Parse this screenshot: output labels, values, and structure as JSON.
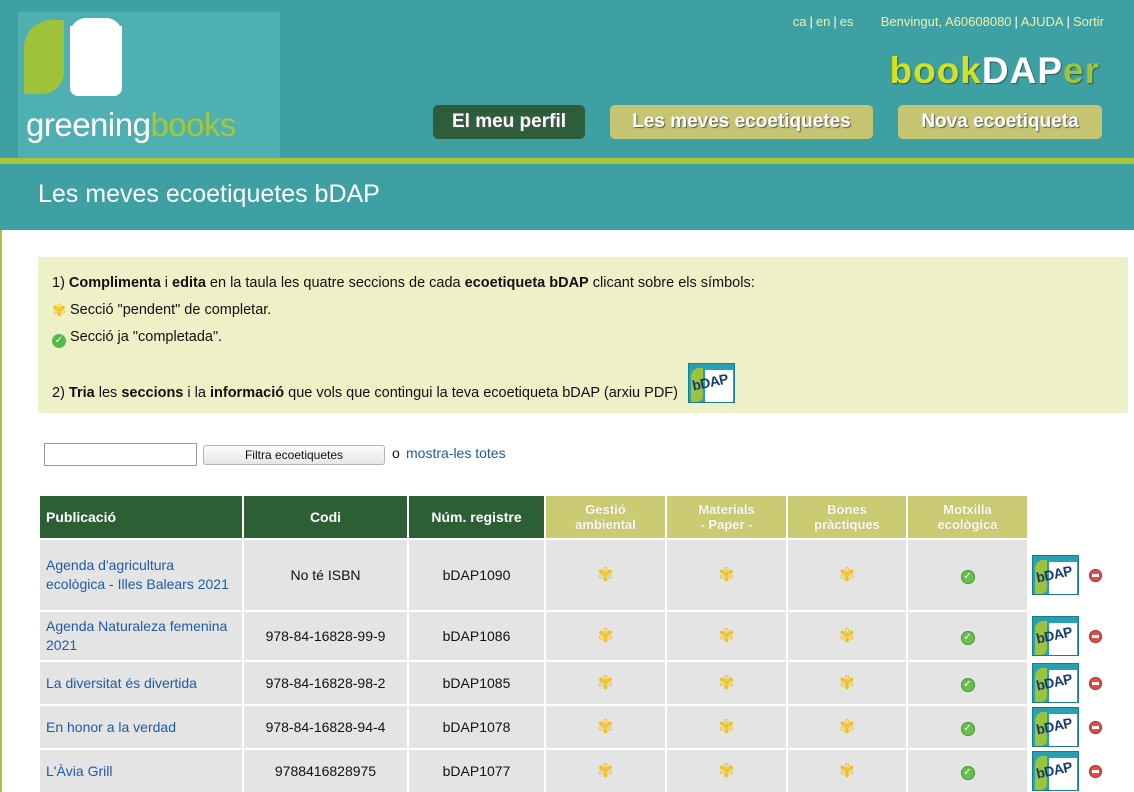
{
  "header": {
    "logo_word_1": "greening",
    "logo_word_2": "books",
    "lang_ca": "ca",
    "lang_en": "en",
    "lang_es": "es",
    "welcome": "Benvingut, A60608080",
    "help": "AJUDA",
    "logout": "Sortir",
    "brand_1": "book",
    "brand_2": "DAP",
    "brand_3": "er",
    "nav": {
      "profile": "El meu perfil",
      "my_labels": "Les meves ecoetiquetes",
      "new_label": "Nova ecoetiqueta"
    }
  },
  "page_title": "Les meves ecoetiquetes bDAP",
  "instructions": {
    "l1_num": "1) ",
    "l1_b1": "Complimenta",
    "l1_t1": " i ",
    "l1_b2": "edita",
    "l1_t2": " en la taula les quatre seccions de cada ",
    "l1_b3": "ecoetiqueta bDAP",
    "l1_t3": " clicant sobre els símbols:",
    "pending": "Secció \"pendent\" de completar.",
    "done": "Secció ja \"completada\".",
    "l2_num": "2) ",
    "l2_b1": "Tria",
    "l2_t1": " les ",
    "l2_b2": "seccions",
    "l2_t2": " i la ",
    "l2_b3": "informació",
    "l2_t3": " que vols que contingui la teva ecoetiqueta bDAP (arxiu PDF)"
  },
  "bdap_icon_text": "bDAP",
  "filter": {
    "input_value": "",
    "button_label": "Filtra ecoetiquetes",
    "or_text": "o",
    "show_all": "mostra-les totes"
  },
  "table": {
    "headers": {
      "publication": "Publicació",
      "code": "Codi",
      "register": "Núm. registre",
      "env_1": "Gestió",
      "env_2": "ambiental",
      "mat_1": "Materials",
      "mat_2": "- Paper -",
      "good_1": "Bones",
      "good_2": "pràctiques",
      "pack_1": "Motxilla",
      "pack_2": "ecològica"
    },
    "rows": [
      {
        "pub": "Agenda d'agricultura ecològica - Illes Balears 2021",
        "code": "No té ISBN",
        "reg": "bDAP1090"
      },
      {
        "pub": "Agenda Naturaleza femenina 2021",
        "code": "978-84-16828-99-9",
        "reg": "bDAP1086"
      },
      {
        "pub": "La diversitat és divertida",
        "code": "978-84-16828-98-2",
        "reg": "bDAP1085"
      },
      {
        "pub": "En honor a la verdad",
        "code": "978-84-16828-94-4",
        "reg": "bDAP1078"
      },
      {
        "pub": "L'Àvia Grill",
        "code": "9788416828975",
        "reg": "bDAP1077"
      }
    ],
    "status_pending_icon": "pending-flower-icon",
    "status_done_icon": "check-circle-icon"
  },
  "colors": {
    "header_teal": "#3fa0a3",
    "dark_green": "#2c5f34",
    "olive": "#c6c573",
    "lime": "#a4c639",
    "link_blue": "#1f5aa8"
  }
}
